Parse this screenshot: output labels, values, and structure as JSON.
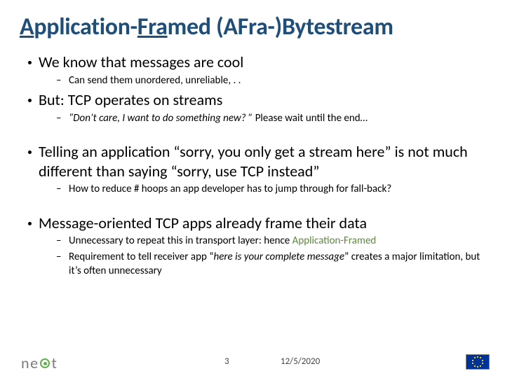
{
  "title": {
    "prefix": "A",
    "mid1": "pplication-",
    "u2": "Fra",
    "mid2": "med (AFra-)Bytestream"
  },
  "bullets": [
    {
      "text": "We know that messages are cool",
      "sub": [
        {
          "text": "Can send them unordered, unreliable, . ."
        }
      ]
    },
    {
      "text": "But: TCP operates on streams",
      "sub": [
        {
          "prefix": "“Don’t care, I want to do something new? ”",
          "rest": " Please wait until the end…",
          "prefix_italic": true
        }
      ]
    },
    {
      "spacer": true,
      "text": "Telling an application “sorry, you only get a stream here” is not much different than saying “sorry, use TCP instead”",
      "sub": [
        {
          "text": "How to reduce # hoops an app developer has to jump through for fall-back?"
        }
      ]
    },
    {
      "spacer": true,
      "text": "Message-oriented TCP apps already frame their data",
      "sub": [
        {
          "plain": "Unnecessary to repeat this in transport layer: hence ",
          "green": "Application-Framed"
        },
        {
          "plain": "Requirement to tell receiver app “",
          "italic": "here is your complete message",
          "plain2": "” creates a major limitation, but it’s often unnecessary"
        }
      ]
    }
  ],
  "footer": {
    "logo": "neat",
    "page": "3",
    "date": "12/5/2020"
  }
}
